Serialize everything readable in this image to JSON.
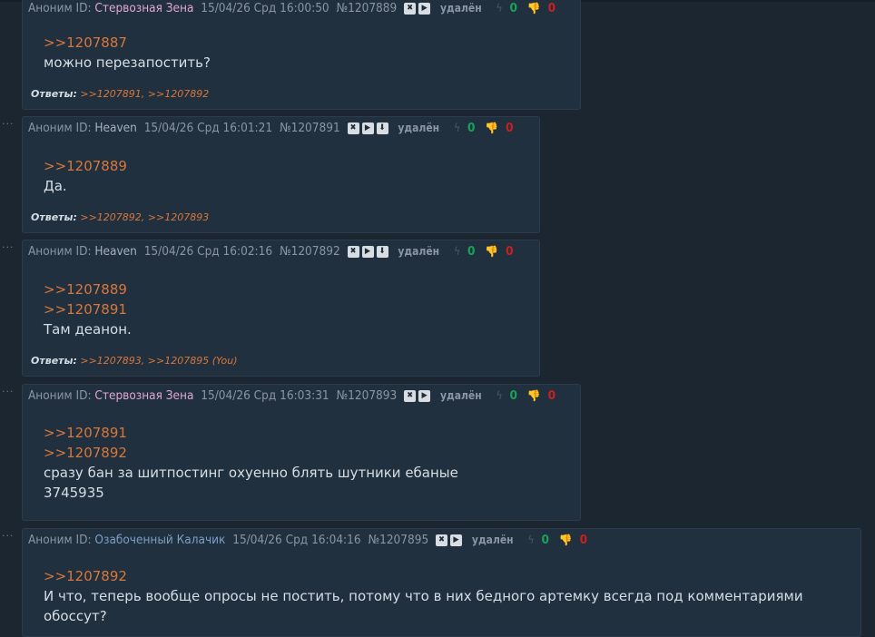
{
  "posts": [
    {
      "anon": "Аноним ID:",
      "name": "Стервозная Зена",
      "date": "15/04/26 Срд 16:00:50",
      "num": "№1207889",
      "deleted": "удалён",
      "likes": "0",
      "dislikes": "0",
      "refs": [
        ">>1207887"
      ],
      "lines": [
        "можно перезапостить?"
      ],
      "answers_label": "Ответы:",
      "answers": ">>1207891, >>1207892"
    },
    {
      "anon": "Аноним ID:",
      "name": "Heaven",
      "date": "15/04/26 Срд 16:01:21",
      "num": "№1207891",
      "deleted": "удалён",
      "likes": "0",
      "dislikes": "0",
      "refs": [
        ">>1207889"
      ],
      "lines": [
        "Да."
      ],
      "answers_label": "Ответы:",
      "answers": ">>1207892, >>1207893"
    },
    {
      "anon": "Аноним ID:",
      "name": "Heaven",
      "date": "15/04/26 Срд 16:02:16",
      "num": "№1207892",
      "deleted": "удалён",
      "likes": "0",
      "dislikes": "0",
      "refs": [
        ">>1207889",
        ">>1207891"
      ],
      "lines": [
        "Там деанон."
      ],
      "answers_label": "Ответы:",
      "answers": ">>1207893, >>1207895 (You)"
    },
    {
      "anon": "Аноним ID:",
      "name": "Стервозная Зена",
      "date": "15/04/26 Срд 16:03:31",
      "num": "№1207893",
      "deleted": "удалён",
      "likes": "0",
      "dislikes": "0",
      "refs": [
        ">>1207891",
        ">>1207892"
      ],
      "lines": [
        "сразу бан за шитпостинг охуенно блять шутники ебаные",
        "3745935"
      ]
    },
    {
      "anon": "Аноним ID:",
      "name": "Озабоченный Калачик",
      "date": "15/04/26 Срд 16:04:16",
      "num": "№1207895",
      "deleted": "удалён",
      "likes": "0",
      "dislikes": "0",
      "refs": [
        ">>1207892"
      ],
      "lines": [
        "И что, теперь вообще опросы не постить, потому что в них бедного артемку всегда под комментариями обоссут?"
      ]
    }
  ],
  "dots": "···",
  "icons": {
    "close": "✖",
    "play": "▶",
    "download": "⬇",
    "bolt": "ϟ",
    "thumb": "👎"
  }
}
